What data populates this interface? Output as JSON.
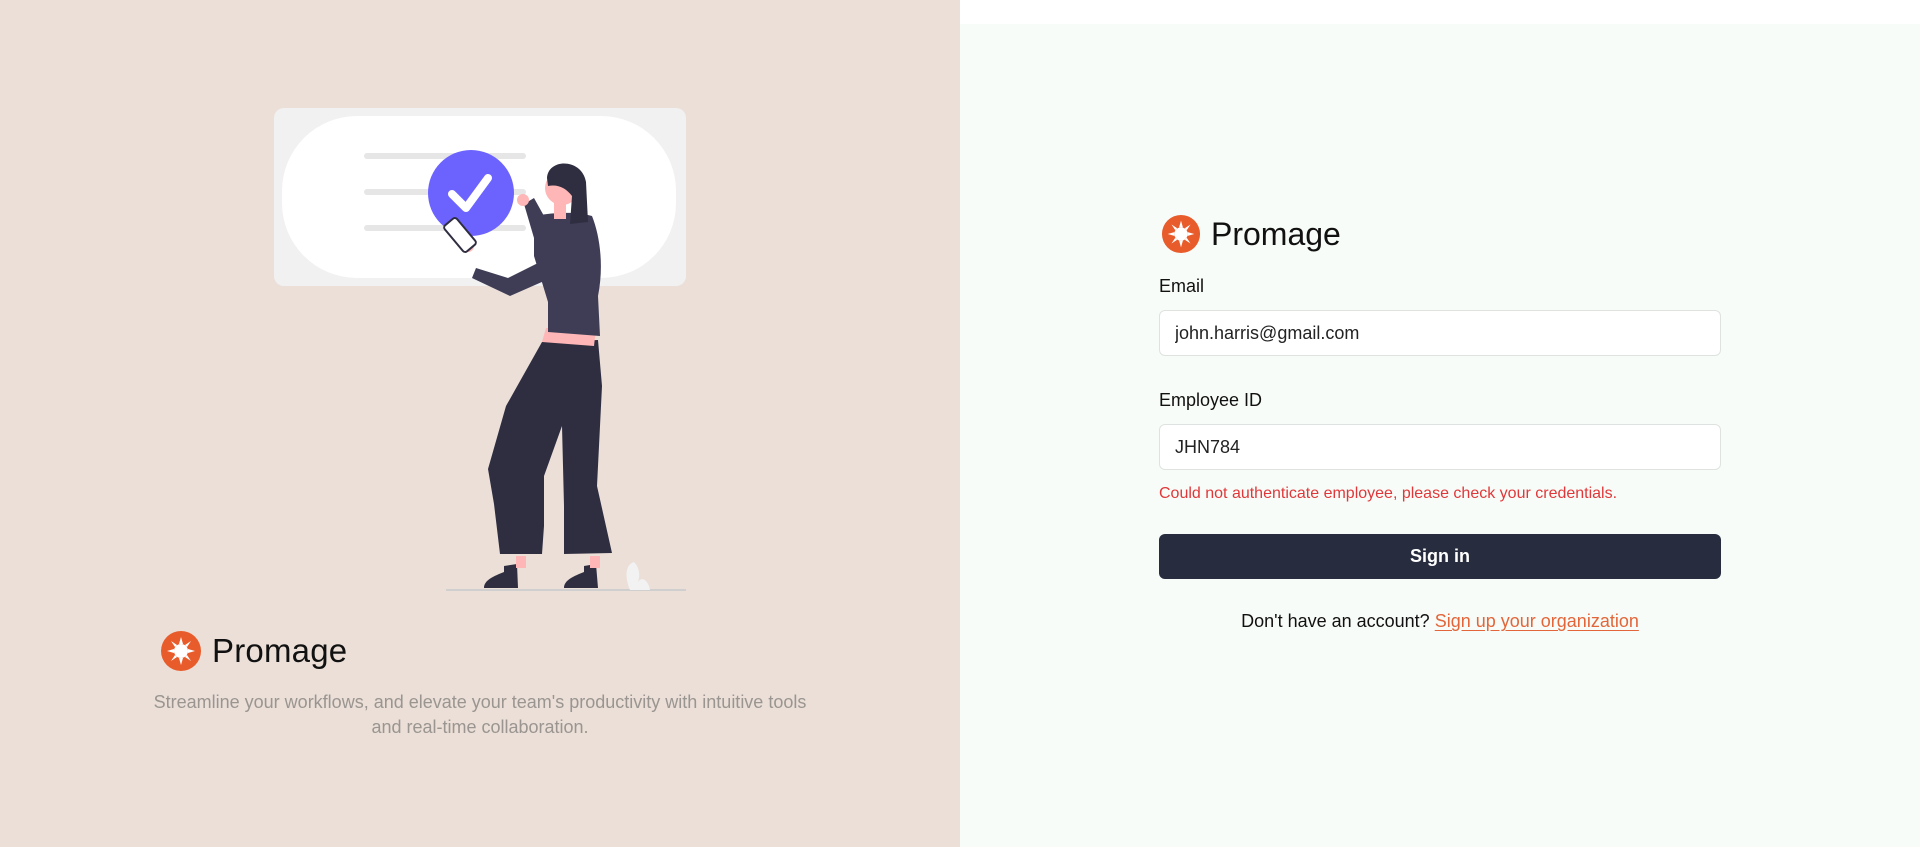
{
  "brand": {
    "name": "Promage",
    "logo_icon": "sun-badge-icon",
    "accent_color": "#e85c2b"
  },
  "left_panel": {
    "tagline": "Streamline your workflows, and elevate your team's productivity with intuitive tools and real-time collaboration.",
    "illustration": "woman-holding-phone-with-checkmark-illustration",
    "background_color": "#ebdfd8"
  },
  "form": {
    "email": {
      "label": "Email",
      "value": "john.harris@gmail.com"
    },
    "employee_id": {
      "label": "Employee ID",
      "value": "JHN784"
    },
    "error_message": "Could not authenticate employee, please check your credentials.",
    "submit_label": "Sign in",
    "signup_prompt": "Don't have an account?",
    "signup_link": "Sign up your organization"
  },
  "colors": {
    "primary_button": "#272d3f",
    "error": "#e0383a",
    "link": "#e2663a",
    "right_background": "#f8fcf8"
  }
}
